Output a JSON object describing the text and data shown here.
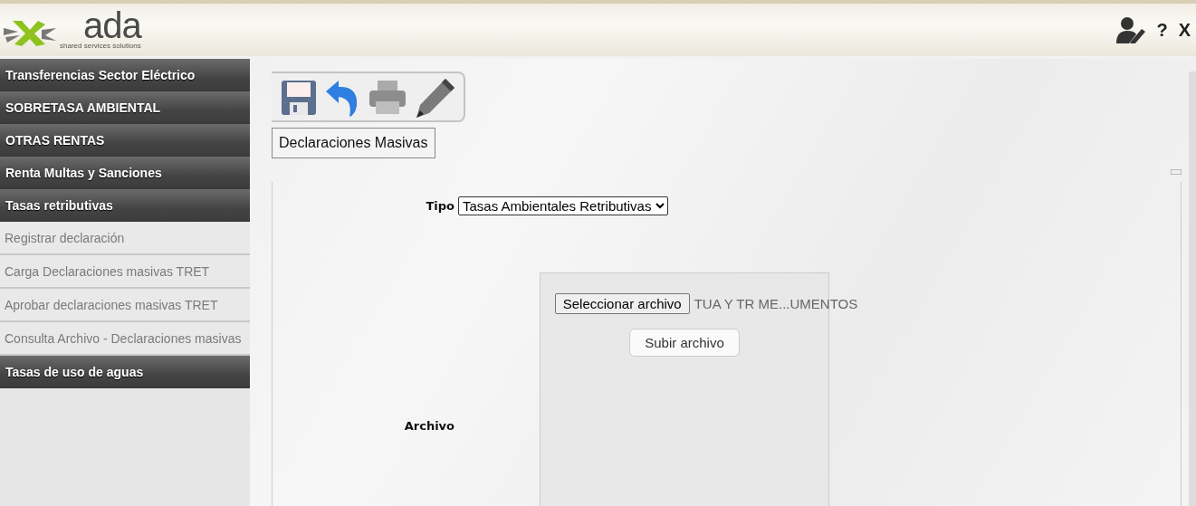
{
  "header": {
    "logo_text": "ada",
    "logo_tagline": "shared services solutions",
    "actions": [
      {
        "kind": "user"
      },
      {
        "kind": "text",
        "label": "?"
      },
      {
        "kind": "text",
        "label": "X"
      }
    ]
  },
  "sidebar": {
    "items": [
      {
        "label": "Transferencias Sector Eléctrico",
        "kind": "section"
      },
      {
        "label": "SOBRETASA AMBIENTAL",
        "kind": "section"
      },
      {
        "label": "OTRAS RENTAS",
        "kind": "section"
      },
      {
        "label": "Renta Multas y Sanciones",
        "kind": "section"
      },
      {
        "label": "Tasas retributivas",
        "kind": "section"
      },
      {
        "label": "Registrar declaración",
        "kind": "link"
      },
      {
        "label": "Carga Declaraciones masivas TRET",
        "kind": "link"
      },
      {
        "label": "Aprobar declaraciones masivas TRET",
        "kind": "link"
      },
      {
        "label": "Consulta Archivo - Declaraciones masivas",
        "kind": "link"
      },
      {
        "label": "Tasas de uso de aguas",
        "kind": "section"
      }
    ]
  },
  "toolbar": [
    {
      "kind": "save"
    },
    {
      "kind": "undo"
    },
    {
      "kind": "print"
    },
    {
      "kind": "edit"
    }
  ],
  "page_title": "Declaraciones Masivas",
  "form": {
    "tipo_label": "Tipo",
    "tipo_value": "Tasas Ambientales Retributivas",
    "archivo_label": "Archivo",
    "choose_button": "Seleccionar archivo",
    "file_name": "TUA Y TR ME...UMENTOS",
    "upload_button": "Subir archivo"
  }
}
